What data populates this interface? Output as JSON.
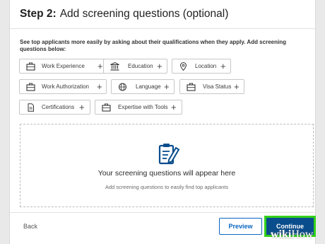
{
  "header": {
    "step": "Step 2:",
    "title": "Add screening questions (optional)"
  },
  "intro": "See top applicants more easily by asking about their qualifications when they apply. Add screening questions below:",
  "chips": {
    "work_experience": "Work Experience",
    "education": "Education",
    "location": "Location",
    "work_authorization": "Work Authorization",
    "language": "Language",
    "visa_status": "Visa Status",
    "certifications": "Certifications",
    "expertise_tools": "Expertise with Tools",
    "plus": "+"
  },
  "empty_state": {
    "title": "Your screening questions will appear here",
    "subtitle": "Add screening questions to easily find top applicants"
  },
  "footer": {
    "back": "Back",
    "preview": "Preview",
    "continue": "Continue"
  },
  "watermark": {
    "wiki": "wiki",
    "how": "How"
  },
  "colors": {
    "accent": "#0a66c2",
    "continue_bg": "#0a4d8c",
    "highlight": "#33d11a"
  }
}
